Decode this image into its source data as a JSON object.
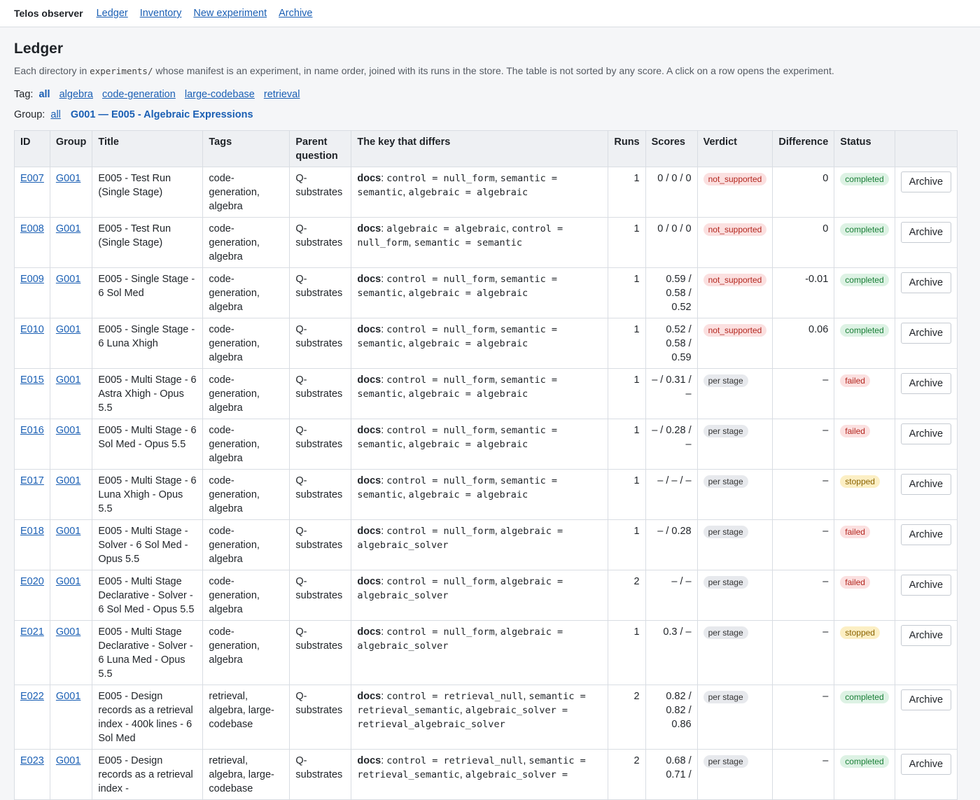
{
  "nav": {
    "brand": "Telos observer",
    "links": [
      "Ledger",
      "Inventory",
      "New experiment",
      "Archive"
    ]
  },
  "page": {
    "title": "Ledger",
    "intro_before": "Each directory in ",
    "intro_code": "experiments/",
    "intro_after": " whose manifest is an experiment, in name order, joined with its runs in the store. The table is not sorted by any score. A click on a row opens the experiment."
  },
  "tag_filter": {
    "label": "Tag:",
    "current": "all",
    "options": [
      "algebra",
      "code-generation",
      "large-codebase",
      "retrieval"
    ]
  },
  "group_filter": {
    "label": "Group:",
    "all": "all",
    "current": "G001 — E005 - Algebraic Expressions"
  },
  "columns": [
    "ID",
    "Group",
    "Title",
    "Tags",
    "Parent question",
    "The key that differs",
    "Runs",
    "Scores",
    "Verdict",
    "Difference",
    "Status",
    ""
  ],
  "archive_label": "Archive",
  "rows": [
    {
      "id": "E007",
      "group": "G001",
      "title": "E005 - Test Run (Single Stage)",
      "tags": "code-generation, algebra",
      "parent": "Q-substrates",
      "diff_key": "docs",
      "diff_parts": [
        "control = null_form",
        "semantic = semantic",
        "algebraic = algebraic"
      ],
      "runs": "1",
      "scores": "0 / 0 / 0",
      "verdict": "not_supported",
      "verdict_kind": "ns",
      "difference": "0",
      "status": "completed"
    },
    {
      "id": "E008",
      "group": "G001",
      "title": "E005 - Test Run (Single Stage)",
      "tags": "code-generation, algebra",
      "parent": "Q-substrates",
      "diff_key": "docs",
      "diff_parts": [
        "algebraic = algebraic",
        "control = null_form",
        "semantic = semantic"
      ],
      "runs": "1",
      "scores": "0 / 0 / 0",
      "verdict": "not_supported",
      "verdict_kind": "ns",
      "difference": "0",
      "status": "completed"
    },
    {
      "id": "E009",
      "group": "G001",
      "title": "E005 - Single Stage - 6 Sol Med",
      "tags": "code-generation, algebra",
      "parent": "Q-substrates",
      "diff_key": "docs",
      "diff_parts": [
        "control = null_form",
        "semantic = semantic",
        "algebraic = algebraic"
      ],
      "runs": "1",
      "scores": "0.59 / 0.58 / 0.52",
      "verdict": "not_supported",
      "verdict_kind": "ns",
      "difference": "-0.01",
      "status": "completed"
    },
    {
      "id": "E010",
      "group": "G001",
      "title": "E005 - Single Stage - 6 Luna Xhigh",
      "tags": "code-generation, algebra",
      "parent": "Q-substrates",
      "diff_key": "docs",
      "diff_parts": [
        "control = null_form",
        "semantic = semantic",
        "algebraic = algebraic"
      ],
      "runs": "1",
      "scores": "0.52 / 0.58 / 0.59",
      "verdict": "not_supported",
      "verdict_kind": "ns",
      "difference": "0.06",
      "status": "completed"
    },
    {
      "id": "E015",
      "group": "G001",
      "title": "E005 - Multi Stage - 6 Astra Xhigh - Opus 5.5",
      "tags": "code-generation, algebra",
      "parent": "Q-substrates",
      "diff_key": "docs",
      "diff_parts": [
        "control = null_form",
        "semantic = semantic",
        "algebraic = algebraic"
      ],
      "runs": "1",
      "scores": "– / 0.31 / –",
      "verdict": "per stage",
      "verdict_kind": "ps",
      "difference": "–",
      "status": "failed"
    },
    {
      "id": "E016",
      "group": "G001",
      "title": "E005 - Multi Stage - 6 Sol Med - Opus 5.5",
      "tags": "code-generation, algebra",
      "parent": "Q-substrates",
      "diff_key": "docs",
      "diff_parts": [
        "control = null_form",
        "semantic = semantic",
        "algebraic = algebraic"
      ],
      "runs": "1",
      "scores": "– / 0.28 / –",
      "verdict": "per stage",
      "verdict_kind": "ps",
      "difference": "–",
      "status": "failed"
    },
    {
      "id": "E017",
      "group": "G001",
      "title": "E005 - Multi Stage - 6 Luna Xhigh - Opus 5.5",
      "tags": "code-generation, algebra",
      "parent": "Q-substrates",
      "diff_key": "docs",
      "diff_parts": [
        "control = null_form",
        "semantic = semantic",
        "algebraic = algebraic"
      ],
      "runs": "1",
      "scores": "– / – / –",
      "verdict": "per stage",
      "verdict_kind": "ps",
      "difference": "–",
      "status": "stopped"
    },
    {
      "id": "E018",
      "group": "G001",
      "title": "E005 - Multi Stage - Solver - 6 Sol Med - Opus 5.5",
      "tags": "code-generation, algebra",
      "parent": "Q-substrates",
      "diff_key": "docs",
      "diff_parts": [
        "control = null_form",
        "algebraic = algebraic_solver"
      ],
      "runs": "1",
      "scores": "– / 0.28",
      "verdict": "per stage",
      "verdict_kind": "ps",
      "difference": "–",
      "status": "failed"
    },
    {
      "id": "E020",
      "group": "G001",
      "title": "E005 - Multi Stage Declarative - Solver - 6 Sol Med - Opus 5.5",
      "tags": "code-generation, algebra",
      "parent": "Q-substrates",
      "diff_key": "docs",
      "diff_parts": [
        "control = null_form",
        "algebraic = algebraic_solver"
      ],
      "runs": "2",
      "scores": "– / –",
      "verdict": "per stage",
      "verdict_kind": "ps",
      "difference": "–",
      "status": "failed"
    },
    {
      "id": "E021",
      "group": "G001",
      "title": "E005 - Multi Stage Declarative - Solver - 6 Luna Med - Opus 5.5",
      "tags": "code-generation, algebra",
      "parent": "Q-substrates",
      "diff_key": "docs",
      "diff_parts": [
        "control = null_form",
        "algebraic = algebraic_solver"
      ],
      "runs": "1",
      "scores": "0.3 / –",
      "verdict": "per stage",
      "verdict_kind": "ps",
      "difference": "–",
      "status": "stopped"
    },
    {
      "id": "E022",
      "group": "G001",
      "title": "E005 - Design records as a retrieval index - 400k lines - 6 Sol Med",
      "tags": "retrieval, algebra, large-codebase",
      "parent": "Q-substrates",
      "diff_key": "docs",
      "diff_parts": [
        "control = retrieval_null",
        "semantic = retrieval_semantic",
        "algebraic_solver = retrieval_algebraic_solver"
      ],
      "runs": "2",
      "scores": "0.82 / 0.82 / 0.86",
      "verdict": "per stage",
      "verdict_kind": "ps",
      "difference": "–",
      "status": "completed"
    },
    {
      "id": "E023",
      "group": "G001",
      "title": "E005 - Design records as a retrieval index -",
      "tags": "retrieval, algebra, large-codebase",
      "parent": "Q-substrates",
      "diff_key": "docs",
      "diff_parts": [
        "control = retrieval_null",
        "semantic = retrieval_semantic",
        "algebraic_solver ="
      ],
      "runs": "2",
      "scores": "0.68 / 0.71 /",
      "verdict": "per stage",
      "verdict_kind": "ps",
      "difference": "–",
      "status": "completed"
    }
  ]
}
